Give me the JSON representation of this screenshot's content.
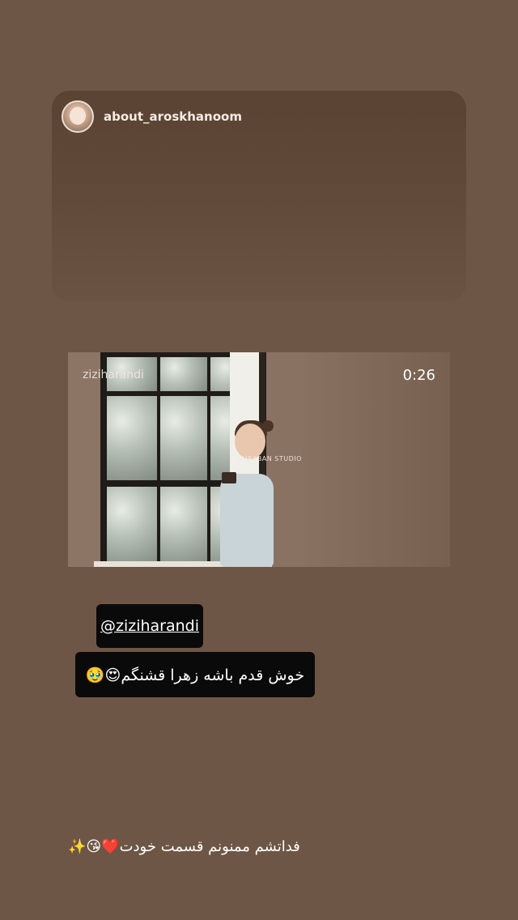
{
  "story_header": {
    "username": "about_aroskhanoom",
    "avatar_icon": "profile-avatar"
  },
  "video": {
    "watermark": "ziziharandi",
    "duration": "0:26",
    "studio_mark": "SHRABAN STUDIO"
  },
  "mention": {
    "text": "@ziziharandi"
  },
  "caption": {
    "text": "خوش قدم باشه زهرا قشنگم😍🥹"
  },
  "bottom_caption": {
    "text": "فداتشم ممنونم قسمت خودت❤️😘✨"
  },
  "colors": {
    "background": "#6e5646",
    "chip_background": "#0a0a0a",
    "text_primary": "#ffffff"
  }
}
